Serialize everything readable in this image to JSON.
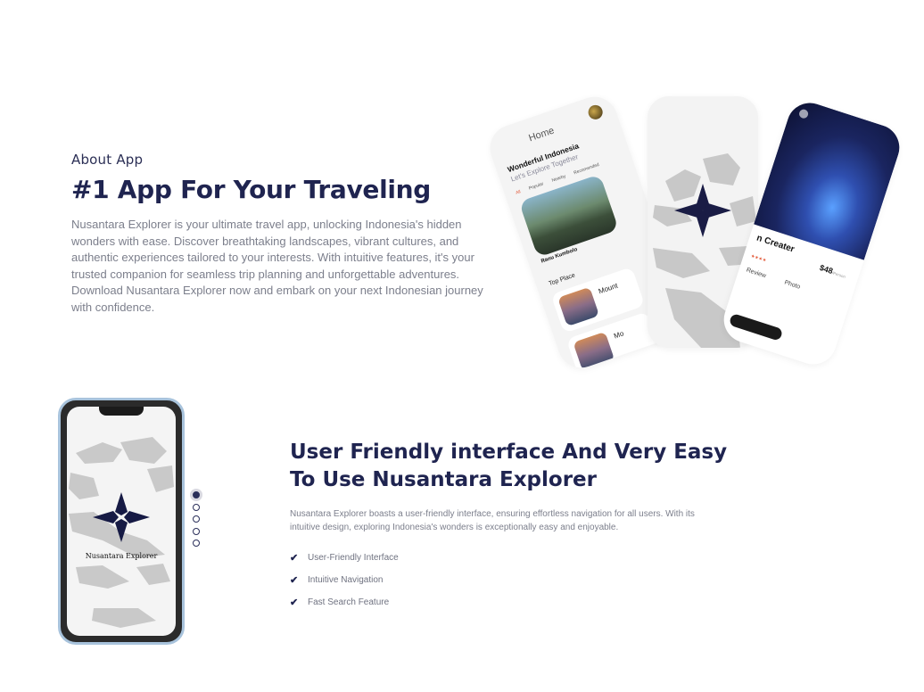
{
  "about": {
    "eyebrow": "About App",
    "headline": "#1 App For Your Traveling",
    "description": "Nusantara Explorer is your ultimate travel app, unlocking Indonesia's hidden wonders with ease. Discover breathtaking landscapes, vibrant cultures, and authentic experiences tailored to your interests. With intuitive features, it's your trusted companion for seamless trip planning and unforgettable adventures. Download Nusantara Explorer now and embark on your next Indonesian journey with confidence."
  },
  "mockup_home": {
    "title": "Home",
    "heading": "Wonderful Indonesia",
    "subheading": "Let's Explore Together",
    "tabs": [
      "All",
      "Popular",
      "Nearby",
      "Recomended"
    ],
    "featured_name": "Ranu Kumbolo",
    "top_place_label": "Top Place",
    "top_places": [
      "Mount",
      "Mo"
    ]
  },
  "mockup_detail": {
    "title": "n Creater",
    "price": "$48",
    "price_unit": "/Person",
    "tabs": [
      "Review",
      "Photo"
    ]
  },
  "phone": {
    "brand": "Nusantara Explorer"
  },
  "carousel": {
    "count": 5,
    "active_index": 0
  },
  "feature": {
    "title": "User Friendly interface And Very Easy To Use Nusantara Explorer",
    "description": "Nusantara Explorer boasts a user-friendly interface, ensuring effortless navigation for all users. With its intuitive design, exploring Indonesia's wonders is exceptionally easy and enjoyable.",
    "items": [
      "User-Friendly Interface",
      "Intuitive Navigation",
      "Fast Search Feature"
    ]
  },
  "colors": {
    "navy": "#1f2450",
    "body_text": "#7c7f8c",
    "accent": "#e35b3b",
    "phone_frame": "#a8c3dc"
  }
}
